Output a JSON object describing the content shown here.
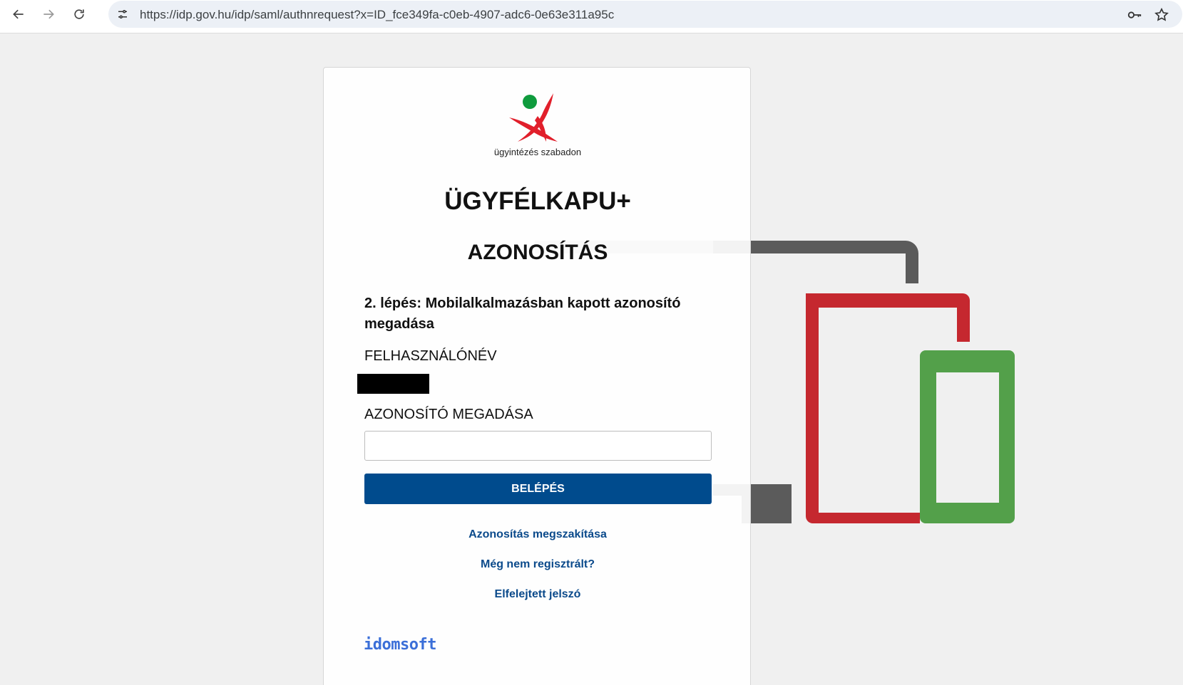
{
  "browser": {
    "url": "https://idp.gov.hu/idp/saml/authnrequest?x=ID_fce349fa-c0eb-4907-adc6-0e63e311a95c",
    "icons": [
      "back-arrow-icon",
      "forward-arrow-icon",
      "reload-icon",
      "site-info-icon",
      "password-key-icon",
      "bookmark-star-icon"
    ]
  },
  "logo": {
    "tagline": "ügyintézés szabadon",
    "colors": {
      "figure": "#e11f2b",
      "head": "#0f9b3d"
    }
  },
  "page": {
    "title": "ÜGYFÉLKAPU+",
    "subtitle": "AZONOSÍTÁS",
    "step": "2. lépés: Mobilalkalmazásban kapott azonosító megadása"
  },
  "form": {
    "username_label": "FELHASZNÁLÓNÉV",
    "code_label": "AZONOSÍTÓ MEGADÁSA",
    "code_value": "",
    "login_button": "BELÉPÉS"
  },
  "links": {
    "cancel": "Azonosítás megszakítása",
    "register": "Még nem regisztrált?",
    "forgot": "Elfelejtett jelszó"
  },
  "footer": {
    "brand": "idomsoft"
  },
  "colors": {
    "primary": "#004b8d",
    "link": "#0b4a8b",
    "device_laptop": "#5a5a5a",
    "device_tablet": "#c5282f",
    "device_phone": "#53a04a"
  }
}
